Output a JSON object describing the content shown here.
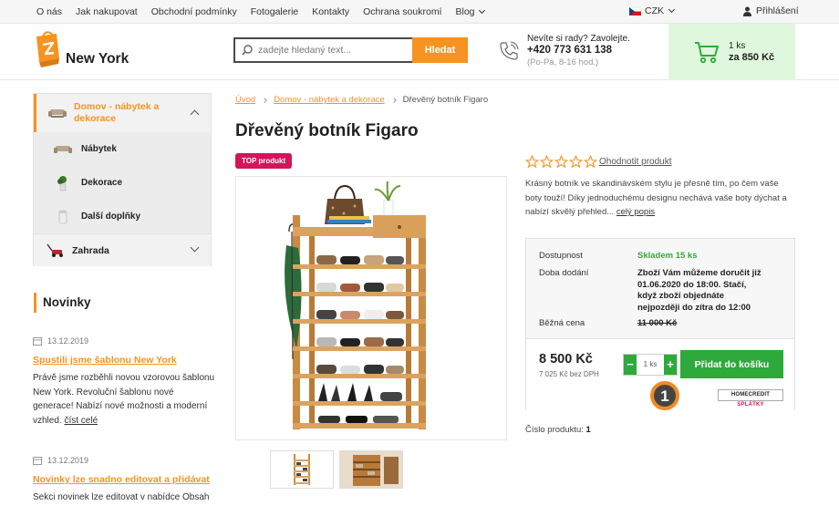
{
  "topnav": {
    "links": [
      "O nás",
      "Jak nakupovat",
      "Obchodní podmínky",
      "Fotogalerie",
      "Kontakty",
      "Ochrana soukromí",
      "Blog"
    ],
    "currency": "CZK",
    "login": "Přihlášení"
  },
  "header": {
    "logo": "New York",
    "search_placeholder": "zadejte hledaný text...",
    "search_button": "Hledat",
    "phone_question": "Nevíte si rady? Zavolejte.",
    "phone_number": "+420 773 631 138",
    "phone_hours": "(Po-Pá, 8-16 hod.)",
    "cart_count": "1 ks",
    "cart_total": "za 850 Kč"
  },
  "sidebar": {
    "active_category": "Domov - nábytek a dekorace",
    "subitems": [
      "Nábytek",
      "Dekorace",
      "Další doplňky"
    ],
    "category2": "Zahrada",
    "news_heading": "Novinky",
    "news": [
      {
        "date": "13.12.2019",
        "title": "Spustili jsme šablonu New York",
        "body": "Právě jsme rozběhli novou vzorovou šablonu New York. Revoluční šablonu nové generace! Nabízí nové možnosti a moderní vzhled.",
        "more": "číst celé"
      },
      {
        "date": "13.12.2019",
        "title": "Novinky lze snadno editovat a přidávat",
        "body": "Sekci novinek lze editovat v nabídce Obsah"
      }
    ]
  },
  "product": {
    "breadcrumb": [
      "Úvod",
      "Domov - nábytek a dekorace",
      "Dřevěný botník Figaro"
    ],
    "title": "Dřevěný botník Figaro",
    "badge": "TOP produkt",
    "rating_link": "Ohodnotit produkt",
    "rating": 0,
    "description": "Krásný botník ve skandinávském stylu je přesně tím, po čem vaše boty touží! Díky jednoduchému designu nechává vaše boty dýchat a nabízí skvělý přehled...",
    "description_more": "celý popis",
    "availability_label": "Dostupnost",
    "availability_value": "Skladem 15 ks",
    "delivery_label": "Doba dodání",
    "delivery_value": "Zboží Vám můžeme doručit již 01.06.2020 do 18:00. Stačí, když zboží objednáte nejpozději do zítra do 12:00",
    "regular_price_label": "Běžná cena",
    "regular_price": "11 000 Kč",
    "price": "8 500 Kč",
    "price_no_vat": "7 025 Kč bez DPH",
    "qty_minus": "−",
    "qty_value": "1 ks",
    "qty_plus": "+",
    "add_to_cart": "Přidat do košíku",
    "homecredit_a": "HOMECREDIT",
    "homecredit_b": "SPLÁTKY",
    "marker": "1",
    "sku_label": "Číslo produktu:",
    "sku_value": "1"
  },
  "colors": {
    "accent": "#f7931e",
    "green": "#2eaa3c",
    "badge": "#d5145a",
    "cart_bg": "#dff7dd"
  }
}
